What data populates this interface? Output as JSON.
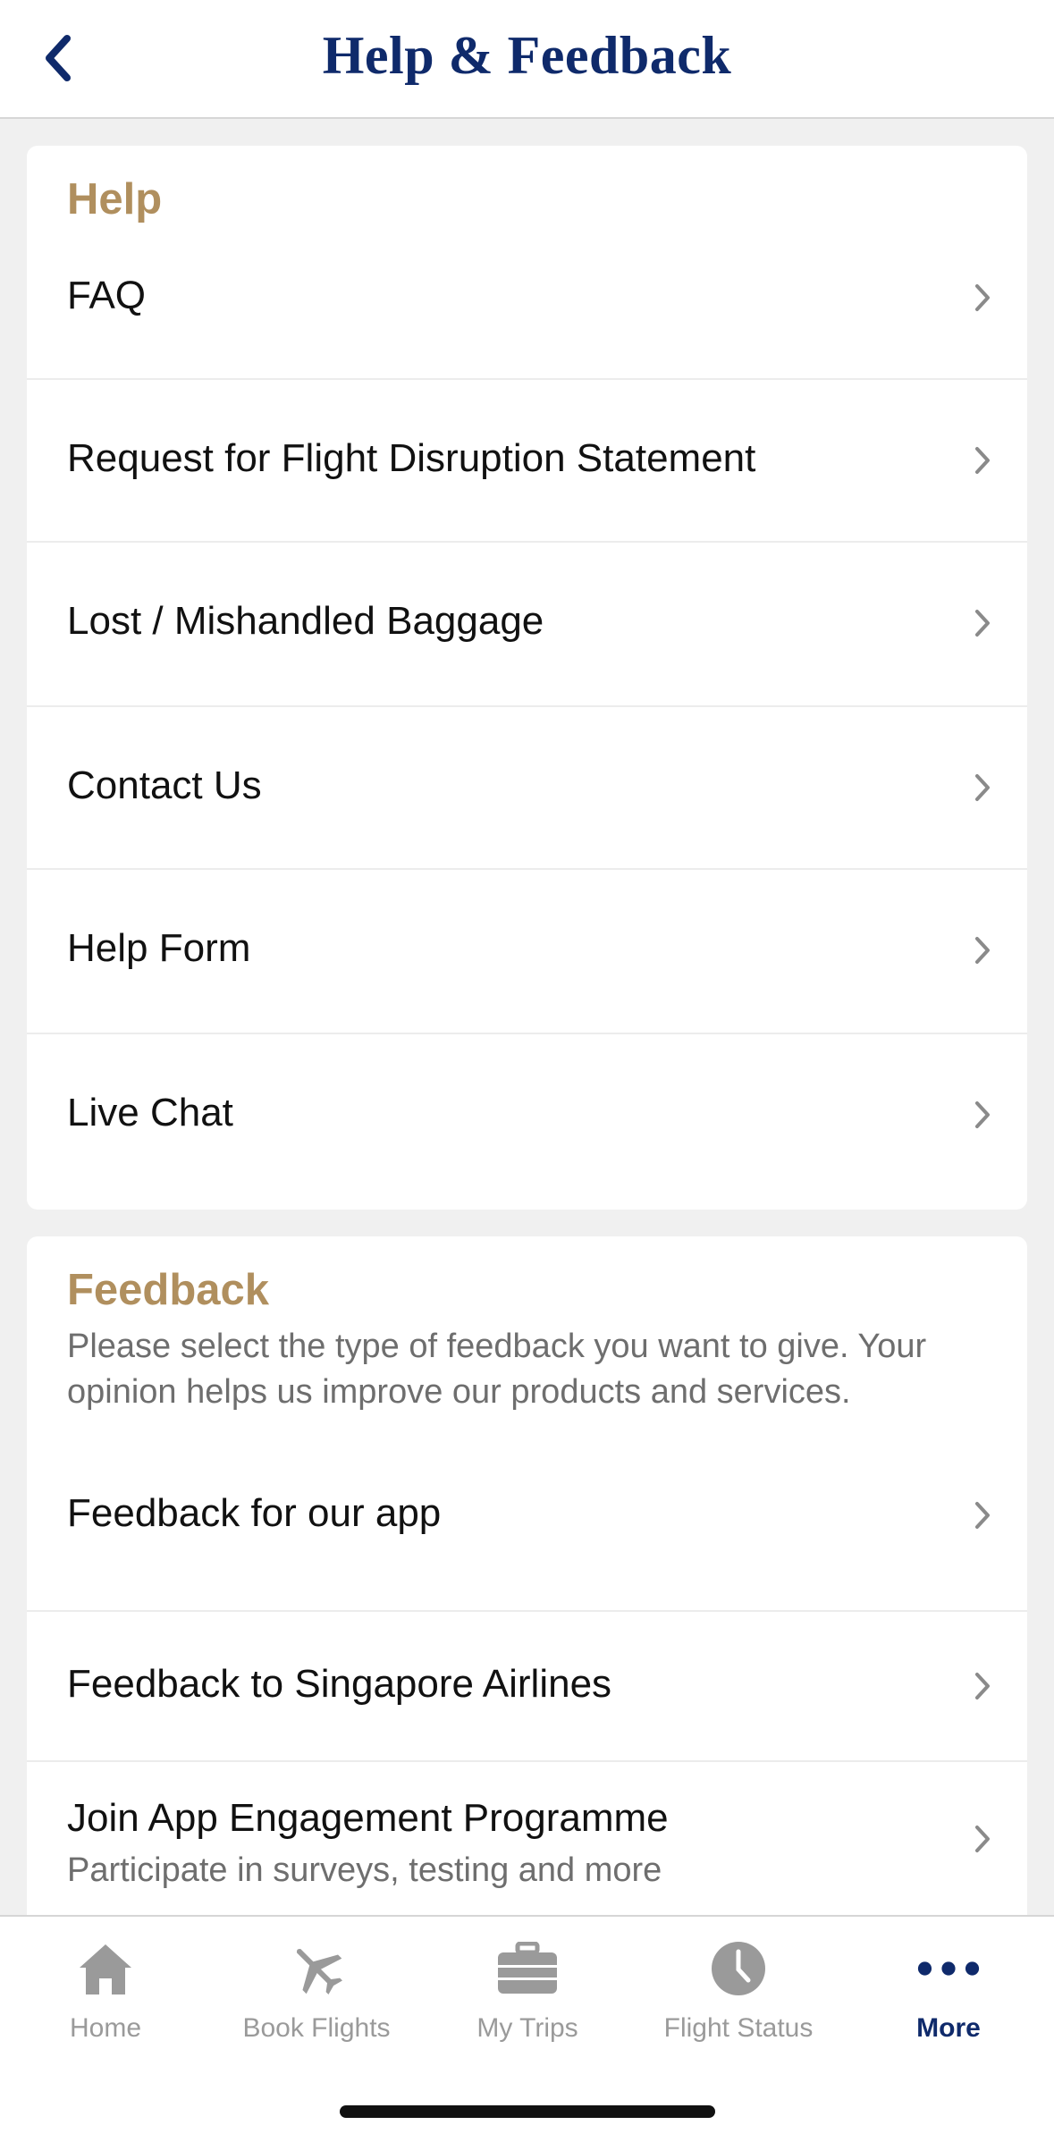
{
  "header": {
    "title": "Help & Feedback"
  },
  "help": {
    "title": "Help",
    "items": [
      {
        "label": "FAQ"
      },
      {
        "label": "Request for Flight Disruption Statement"
      },
      {
        "label": "Lost / Mishandled Baggage"
      },
      {
        "label": "Contact Us"
      },
      {
        "label": "Help Form"
      },
      {
        "label": "Live Chat"
      }
    ]
  },
  "feedback": {
    "title": "Feedback",
    "description": "Please select the type of feedback you want to give. Your opinion helps us improve our products and services.",
    "items": [
      {
        "label": "Feedback for our app"
      },
      {
        "label": "Feedback to Singapore Airlines"
      },
      {
        "label": "Join App Engagement Programme",
        "sublabel": "Participate in surveys, testing and more"
      }
    ]
  },
  "tabbar": {
    "tabs": [
      {
        "label": "Home",
        "icon": "home-icon"
      },
      {
        "label": "Book Flights",
        "icon": "plane-icon"
      },
      {
        "label": "My Trips",
        "icon": "suitcase-icon"
      },
      {
        "label": "Flight Status",
        "icon": "clock-icon"
      },
      {
        "label": "More",
        "icon": "more-dots-icon",
        "active": true
      }
    ]
  },
  "colors": {
    "brand_navy": "#0f2a6b",
    "gold": "#b08f5e",
    "inactive": "#9a9a9a"
  }
}
